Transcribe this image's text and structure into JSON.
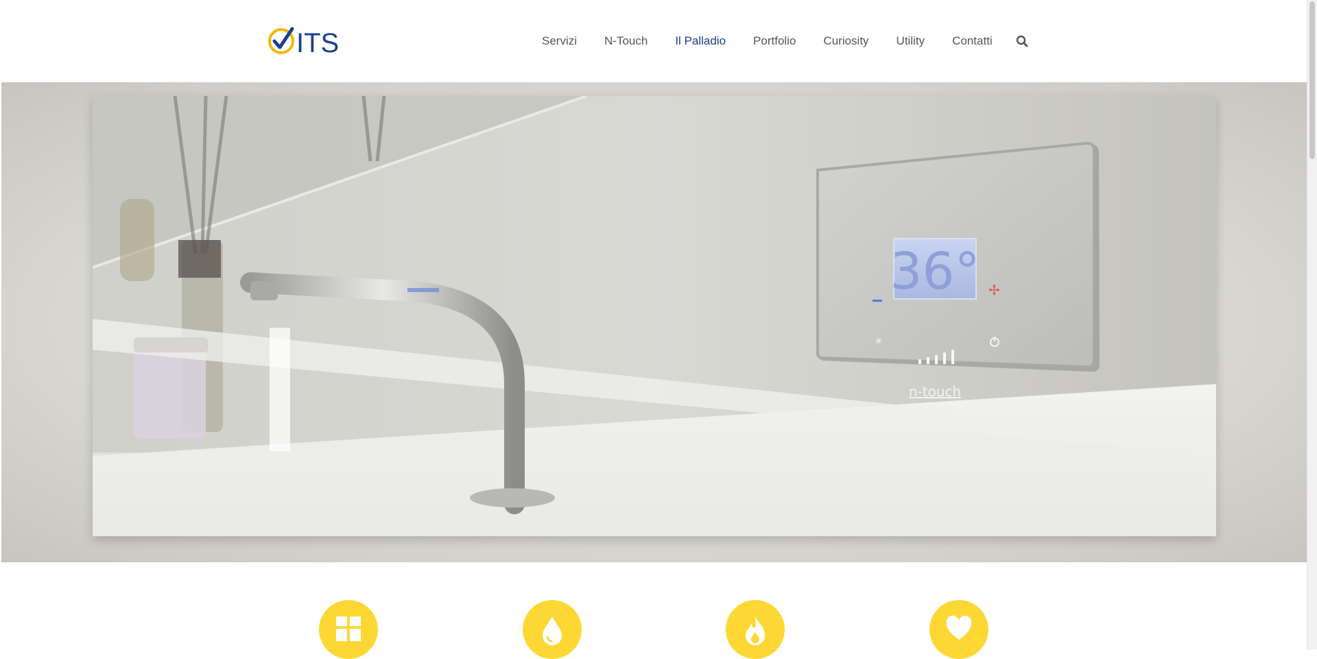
{
  "brand": {
    "logo_text": "ITS",
    "logo_check_color": "#f2b705",
    "logo_text_color": "#1a3e8f"
  },
  "nav": {
    "items": [
      {
        "label": "Servizi",
        "active": false
      },
      {
        "label": "N-Touch",
        "active": false
      },
      {
        "label": "Il Palladio",
        "active": true
      },
      {
        "label": "Portfolio",
        "active": false
      },
      {
        "label": "Curiosity",
        "active": false
      },
      {
        "label": "Utility",
        "active": false
      },
      {
        "label": "Contatti",
        "active": false
      }
    ],
    "search_icon": "search-icon",
    "active_color": "#1a3e8f"
  },
  "hero": {
    "thermostat_temperature": "36°",
    "thermostat_brand": "n-touch"
  },
  "features": {
    "accent_color": "#fdd835",
    "icons": [
      "grid-icon",
      "water-drop-icon",
      "flame-icon",
      "heart-icon"
    ]
  }
}
